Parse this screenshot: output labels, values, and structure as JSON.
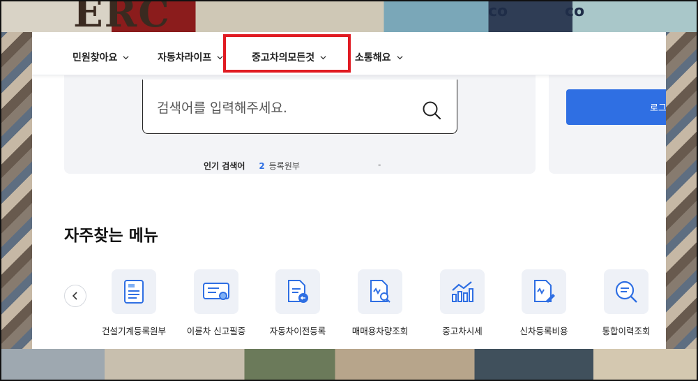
{
  "nav": {
    "items": [
      {
        "label": "민원찾아요"
      },
      {
        "label": "자동차라이프"
      },
      {
        "label": "중고차의모든것"
      },
      {
        "label": "소통해요"
      }
    ]
  },
  "search": {
    "placeholder": "검색어를 입력해주세요.",
    "popular_label": "인기 검색어",
    "popular_rank": "2",
    "popular_term": "등록원부",
    "popular_extra": "-"
  },
  "login": {
    "button_label": "로그"
  },
  "section": {
    "title": "자주찾는 메뉴"
  },
  "menu": {
    "items": [
      {
        "label": "건설기계등록원부",
        "icon": "document-icon"
      },
      {
        "label": "이륜차 신고필증",
        "icon": "certificate-icon"
      },
      {
        "label": "자동차이전등록",
        "icon": "transfer-document-icon"
      },
      {
        "label": "매매용차량조회",
        "icon": "search-document-icon"
      },
      {
        "label": "중고차시세",
        "icon": "chart-icon"
      },
      {
        "label": "신차등록비용",
        "icon": "edit-document-icon"
      },
      {
        "label": "통합이력조회",
        "icon": "magnifier-icon"
      }
    ]
  },
  "colors": {
    "accent": "#2f6fe3",
    "highlight": "#e01b22",
    "card": "#f3f4f7"
  }
}
